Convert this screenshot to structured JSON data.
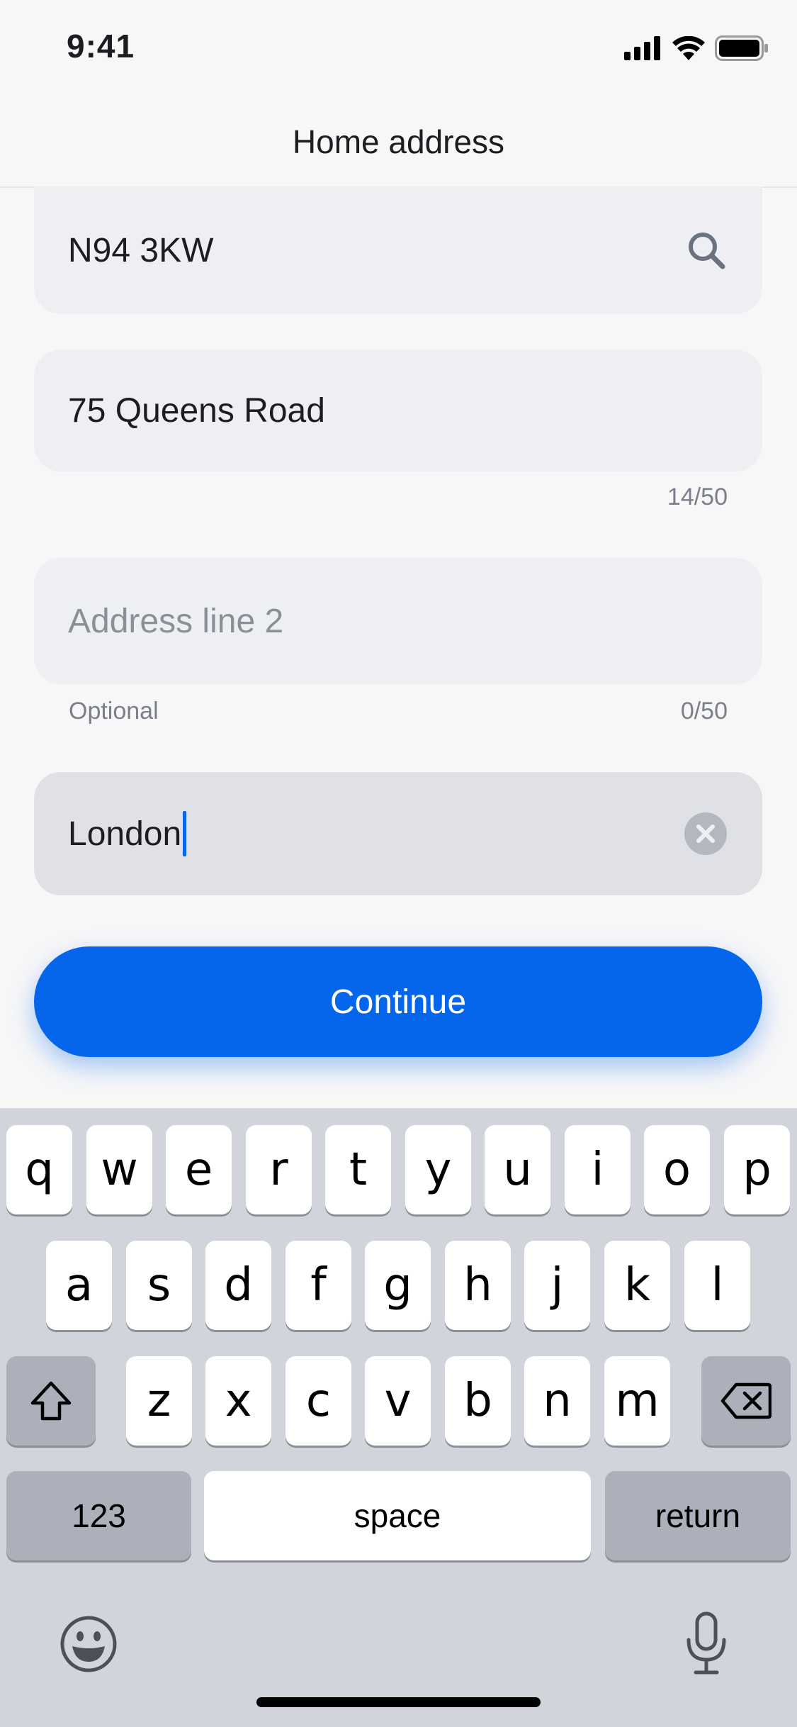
{
  "status_bar": {
    "time": "9:41",
    "icons": [
      "cellular-signal-icon",
      "wifi-icon",
      "battery-icon"
    ]
  },
  "header": {
    "title": "Home address"
  },
  "form": {
    "postcode": {
      "value": "N94 3KW",
      "icon": "search-icon"
    },
    "address_line_1": {
      "value": "75 Queens Road",
      "counter": "14/50"
    },
    "address_line_2": {
      "placeholder": "Address line 2",
      "helper": "Optional",
      "counter": "0/50"
    },
    "city": {
      "value": "London",
      "icon": "clear-icon"
    }
  },
  "continue_button": {
    "label": "Continue"
  },
  "keyboard": {
    "row1": [
      "q",
      "w",
      "e",
      "r",
      "t",
      "y",
      "u",
      "i",
      "o",
      "p"
    ],
    "row2": [
      "a",
      "s",
      "d",
      "f",
      "g",
      "h",
      "j",
      "k",
      "l"
    ],
    "row3": [
      "z",
      "x",
      "c",
      "v",
      "b",
      "n",
      "m"
    ],
    "numbers_label": "123",
    "space_label": "space",
    "return_label": "return",
    "icons": [
      "shift-icon",
      "backspace-icon",
      "emoji-icon",
      "microphone-icon"
    ]
  },
  "colors": {
    "accent": "#0666eb",
    "field_bg": "#eeeff3",
    "keyboard_bg": "#d1d4db"
  }
}
